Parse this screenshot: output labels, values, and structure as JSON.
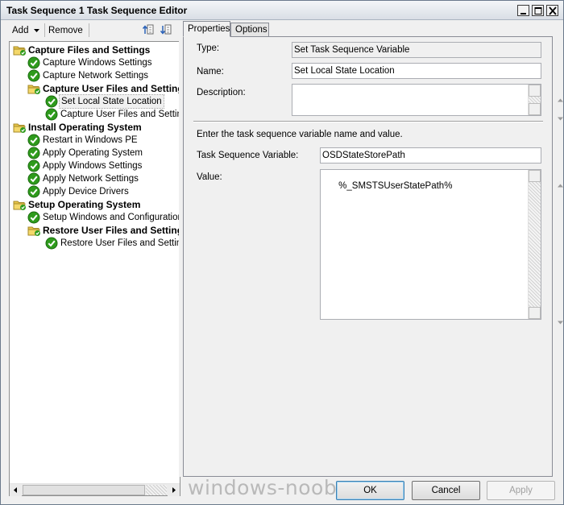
{
  "window": {
    "title": "Task Sequence 1 Task Sequence Editor"
  },
  "toolbar": {
    "add_label": "Add",
    "remove_label": "Remove"
  },
  "tree": {
    "items": [
      {
        "label": "Capture Files and Settings",
        "type": "group",
        "level": 0
      },
      {
        "label": "Capture Windows Settings",
        "type": "step",
        "level": 1
      },
      {
        "label": "Capture Network Settings",
        "type": "step",
        "level": 1
      },
      {
        "label": "Capture User Files and Settings",
        "type": "group",
        "level": 1
      },
      {
        "label": "Set Local State Location",
        "type": "step",
        "level": 2,
        "selected": true
      },
      {
        "label": "Capture User Files and Settings",
        "type": "step",
        "level": 2
      },
      {
        "label": "Install Operating System",
        "type": "group",
        "level": 0
      },
      {
        "label": "Restart in Windows PE",
        "type": "step",
        "level": 1
      },
      {
        "label": "Apply Operating System",
        "type": "step",
        "level": 1
      },
      {
        "label": "Apply Windows Settings",
        "type": "step",
        "level": 1
      },
      {
        "label": "Apply Network Settings",
        "type": "step",
        "level": 1
      },
      {
        "label": "Apply Device Drivers",
        "type": "step",
        "level": 1
      },
      {
        "label": "Setup Operating System",
        "type": "group",
        "level": 0
      },
      {
        "label": "Setup Windows and Configuration",
        "type": "step",
        "level": 1
      },
      {
        "label": "Restore User Files and Settings",
        "type": "group",
        "level": 1
      },
      {
        "label": "Restore User Files and Settings",
        "type": "step",
        "level": 2
      }
    ]
  },
  "tabs": [
    {
      "label": "Properties",
      "active": true
    },
    {
      "label": "Options",
      "active": false
    }
  ],
  "properties": {
    "type_label": "Type:",
    "type_value": "Set Task Sequence Variable",
    "name_label": "Name:",
    "name_value": "Set Local State Location",
    "description_label": "Description:",
    "description_value": "",
    "instruction": "Enter the task sequence variable name and value.",
    "variable_label": "Task Sequence Variable:",
    "variable_value": "OSDStateStorePath",
    "value_label": "Value:",
    "value_value": "%_SMSTSUserStatePath%"
  },
  "buttons": {
    "ok": "OK",
    "cancel": "Cancel",
    "apply": "Apply"
  },
  "watermark": "windows-noob.com",
  "colors": {
    "check_green": "#2e9b1c",
    "folder_yellow": "#e8c54a",
    "border": "#898c95"
  }
}
